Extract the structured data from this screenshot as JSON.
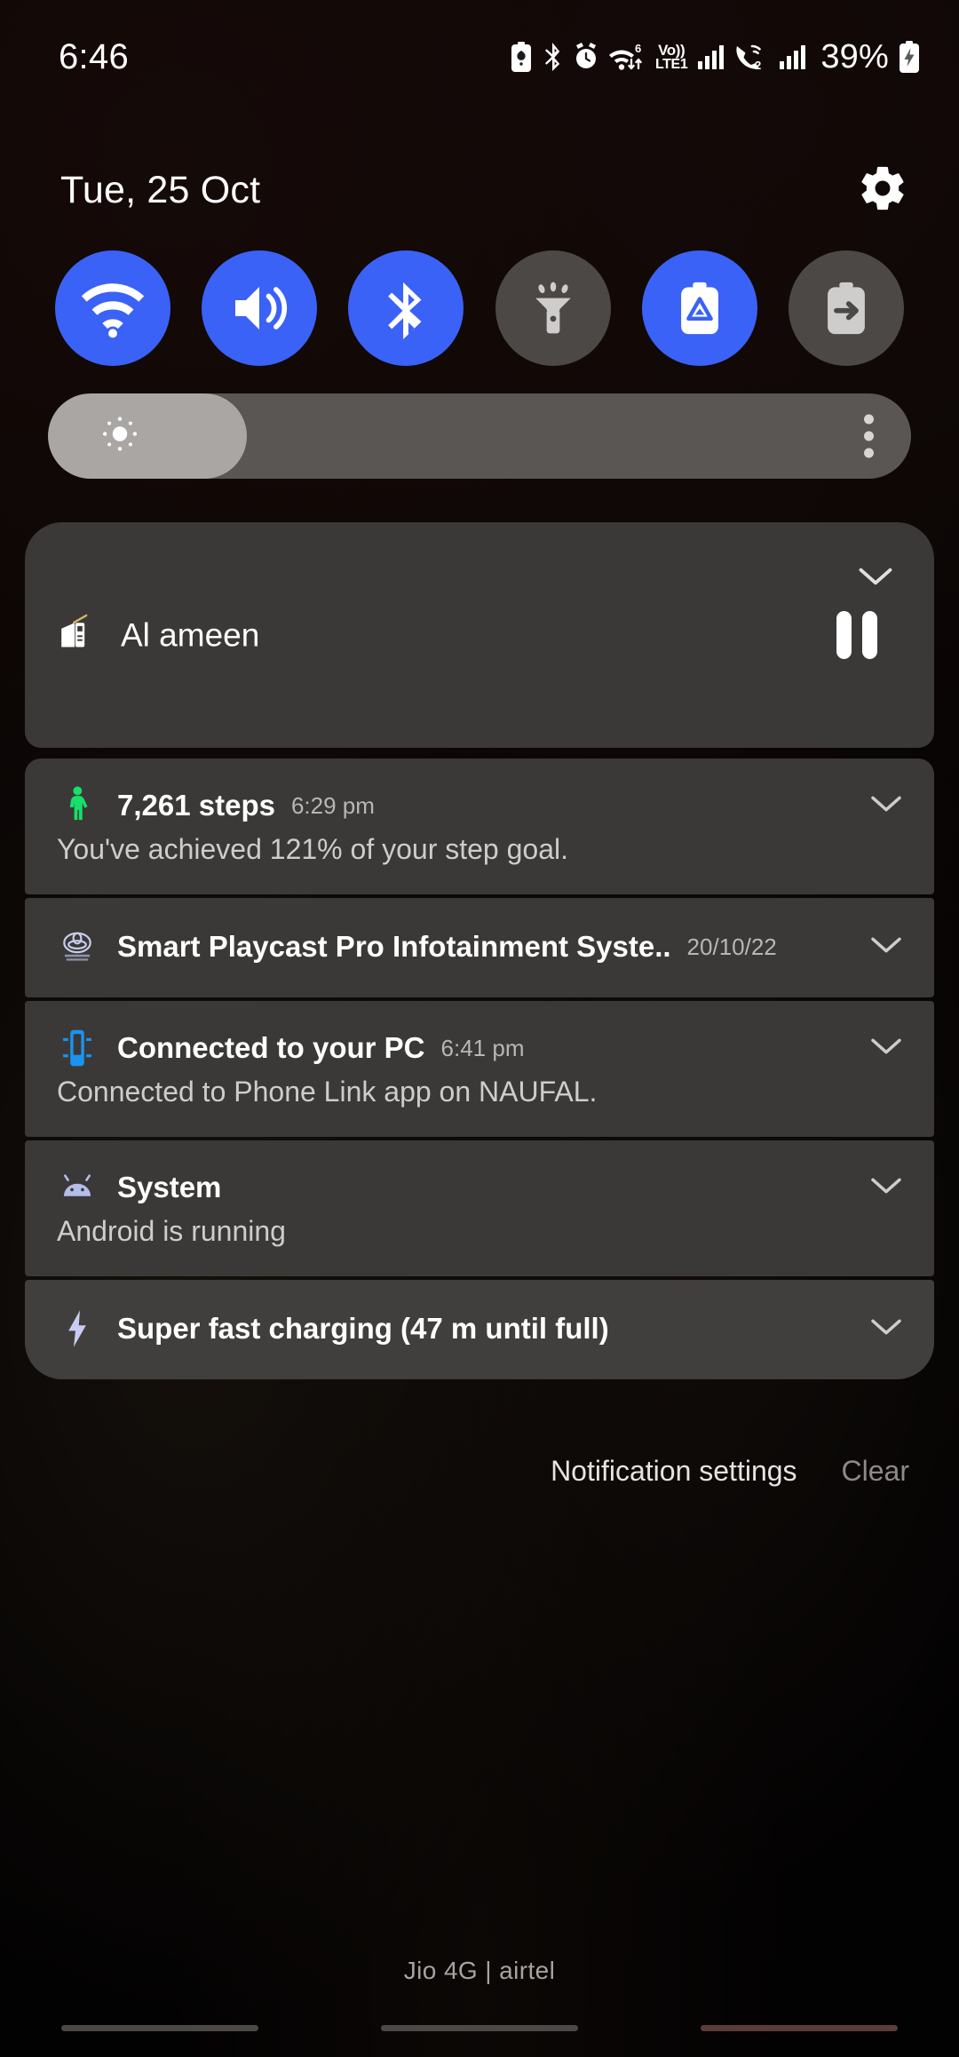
{
  "statusbar": {
    "time": "6:46",
    "battery_percent": "39%",
    "volte_label": "Vo))",
    "volte_sub": "LTE1",
    "wifi_badge": "6",
    "sim2_badge": "2",
    "icons": [
      "battery-saver-icon",
      "bluetooth-icon",
      "alarm-icon",
      "wifi-data-icon",
      "volte-icon",
      "signal-bars-icon",
      "wifi-calling-icon",
      "signal-bars-2-icon",
      "charging-battery-icon"
    ]
  },
  "header": {
    "date": "Tue, 25 Oct",
    "settings_icon": "gear-icon"
  },
  "quick_settings": {
    "tiles": [
      {
        "name": "wifi",
        "label": "Wi-Fi",
        "state": "on",
        "icon": "wifi-icon"
      },
      {
        "name": "sound",
        "label": "Sound",
        "state": "on",
        "icon": "speaker-icon"
      },
      {
        "name": "bluetooth",
        "label": "Bluetooth",
        "state": "on",
        "icon": "bluetooth-icon"
      },
      {
        "name": "flashlight",
        "label": "Flashlight",
        "state": "off",
        "icon": "flashlight-icon"
      },
      {
        "name": "power-saving",
        "label": "Power saving",
        "state": "on",
        "icon": "battery-eco-icon"
      },
      {
        "name": "wireless-powershare",
        "label": "Wireless PowerShare",
        "state": "off",
        "icon": "battery-share-icon"
      }
    ],
    "brightness": {
      "value_percent": 23,
      "icon": "brightness-sun-icon",
      "menu_icon": "kebab-menu-icon"
    },
    "accent_on": "#3b62f6",
    "accent_off": "#4c4846"
  },
  "notifications": {
    "media": {
      "title": "Al ameen",
      "app_icon": "radio-icon",
      "transport_state": "pause-button",
      "expand_icon": "chevron-down-icon"
    },
    "items": [
      {
        "id": "steps",
        "title": "7,261 steps",
        "time": "6:29 pm",
        "body": "You've achieved 121% of your step goal.",
        "icon": "walking-person-icon",
        "icon_color": "#16e06a"
      },
      {
        "id": "infotainment",
        "title": "Smart Playcast Pro Infotainment Syste..",
        "time": "20/10/22",
        "body": "",
        "icon": "car-brand-icon",
        "icon_color": "#c8cdea"
      },
      {
        "id": "phone-link",
        "title": "Connected to your PC",
        "time": "6:41 pm",
        "body": "Connected to Phone Link app on NAUFAL.",
        "icon": "phone-link-icon",
        "icon_color": "#1b93f0"
      },
      {
        "id": "system",
        "title": "System",
        "time": "",
        "body": "Android is running",
        "icon": "android-icon",
        "icon_color": "#b5bdea"
      },
      {
        "id": "charging",
        "title": "Super fast charging (47 m until full)",
        "time": "",
        "body": "",
        "icon": "bolt-icon",
        "icon_color": "#c9ccf2"
      }
    ],
    "actions": {
      "settings_label": "Notification settings",
      "clear_label": "Clear"
    }
  },
  "footer": {
    "carrier": "Jio 4G | airtel"
  }
}
